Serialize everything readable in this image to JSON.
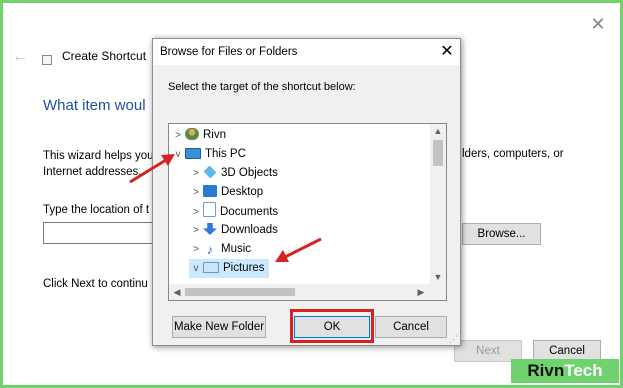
{
  "wizard": {
    "title": "Create Shortcut",
    "heading": "What item woul",
    "description_left_line1": "This wizard helps you",
    "description_left_line2": "Internet addresses.",
    "description_right": "lders, computers, or",
    "location_label": "Type the location of t",
    "browse_label": "Browse...",
    "next_instruction": "Click Next to continu",
    "next_label": "Next",
    "cancel_label": "Cancel"
  },
  "dialog": {
    "title": "Browse for Files or Folders",
    "prompt": "Select the target of the shortcut below:",
    "tree": [
      {
        "label": "Rivn",
        "chevron": ">",
        "icon": "user-icon"
      },
      {
        "label": "This PC",
        "chevron": "v",
        "icon": "pc-icon"
      },
      {
        "label": "3D Objects",
        "chevron": ">",
        "icon": "3d-objects-icon"
      },
      {
        "label": "Desktop",
        "chevron": ">",
        "icon": "desktop-icon"
      },
      {
        "label": "Documents",
        "chevron": ">",
        "icon": "documents-icon"
      },
      {
        "label": "Downloads",
        "chevron": ">",
        "icon": "downloads-icon"
      },
      {
        "label": "Music",
        "chevron": ">",
        "icon": "music-icon"
      },
      {
        "label": "Pictures",
        "chevron": "v",
        "icon": "pictures-icon",
        "selected": true
      }
    ],
    "make_new_folder_label": "Make New Folder",
    "ok_label": "OK",
    "cancel_label": "Cancel"
  },
  "watermark": {
    "brand_a": "Rivn",
    "brand_b": "Tech"
  },
  "colors": {
    "frame_border": "#6fd26f",
    "highlight_red": "#d42323",
    "heading_blue": "#1e4f9c",
    "selected_bg": "#cce8ff"
  }
}
